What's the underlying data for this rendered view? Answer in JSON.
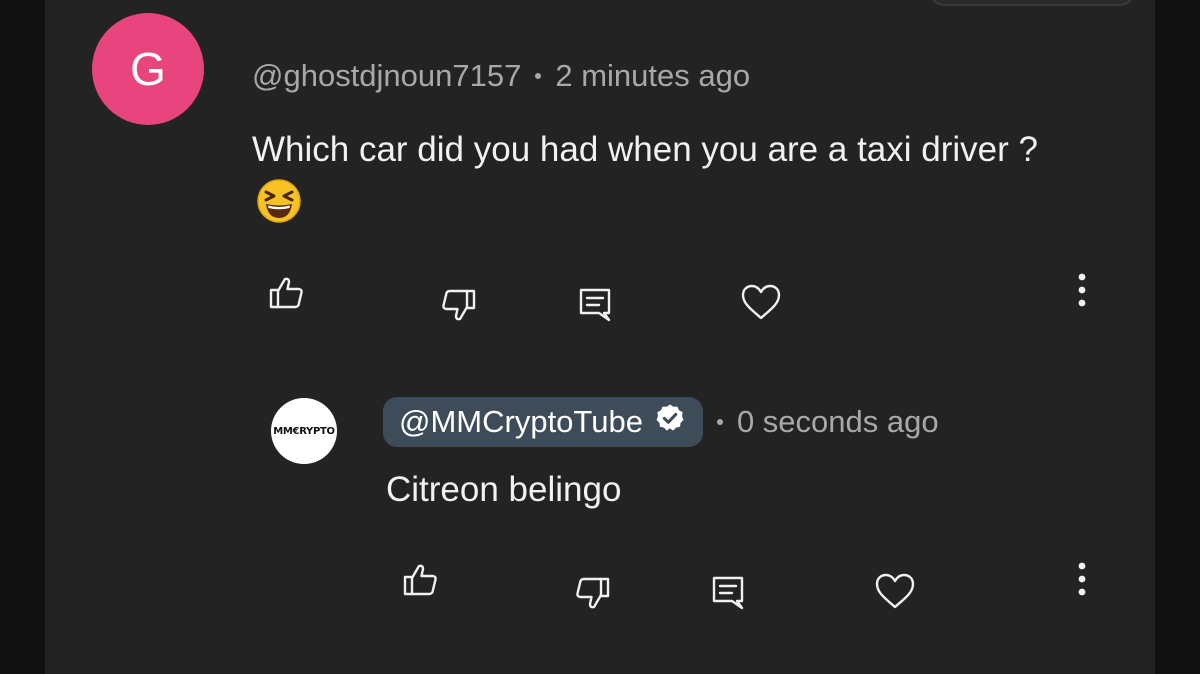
{
  "comment": {
    "avatar_letter": "G",
    "avatar_color": "#e8457f",
    "author": "@ghostdjnoun7157",
    "time": "2 minutes ago",
    "text": "Which car did you had when you are a taxi driver ?",
    "emoji": "grinning-squinting-face",
    "actions": [
      "like-icon",
      "dislike-icon",
      "reply-icon",
      "heart-icon",
      "more-vertical-icon"
    ]
  },
  "reply": {
    "avatar_text": "MM€RYPTO",
    "author": "@MMCryptoTube",
    "verified": true,
    "handle_pill_color": "#3e4b59",
    "time": "0 seconds ago",
    "text": "Citreon belingo",
    "actions": [
      "like-icon",
      "dislike-icon",
      "reply-icon",
      "heart-icon",
      "more-vertical-icon"
    ]
  },
  "colors": {
    "background": "#232323",
    "text": "#f1f1f1",
    "secondary_text": "#a8a8a8"
  }
}
